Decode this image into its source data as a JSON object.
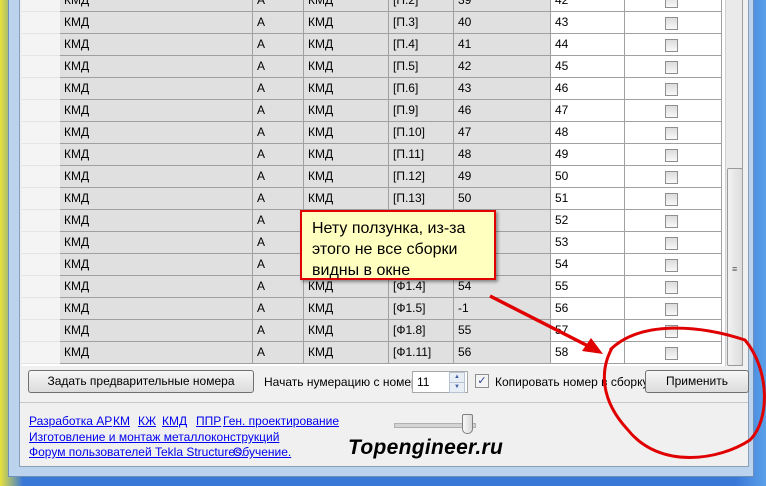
{
  "table": {
    "rows": [
      {
        "c1": "КМД",
        "c2": "А",
        "c3": "КМД",
        "c4": "[П.2]",
        "c5": "39",
        "c6": "42"
      },
      {
        "c1": "КМД",
        "c2": "А",
        "c3": "КМД",
        "c4": "[П.3]",
        "c5": "40",
        "c6": "43"
      },
      {
        "c1": "КМД",
        "c2": "А",
        "c3": "КМД",
        "c4": "[П.4]",
        "c5": "41",
        "c6": "44"
      },
      {
        "c1": "КМД",
        "c2": "А",
        "c3": "КМД",
        "c4": "[П.5]",
        "c5": "42",
        "c6": "45"
      },
      {
        "c1": "КМД",
        "c2": "А",
        "c3": "КМД",
        "c4": "[П.6]",
        "c5": "43",
        "c6": "46"
      },
      {
        "c1": "КМД",
        "c2": "А",
        "c3": "КМД",
        "c4": "[П.9]",
        "c5": "46",
        "c6": "47"
      },
      {
        "c1": "КМД",
        "c2": "А",
        "c3": "КМД",
        "c4": "[П.10]",
        "c5": "47",
        "c6": "48"
      },
      {
        "c1": "КМД",
        "c2": "А",
        "c3": "КМД",
        "c4": "[П.11]",
        "c5": "48",
        "c6": "49"
      },
      {
        "c1": "КМД",
        "c2": "А",
        "c3": "КМД",
        "c4": "[П.12]",
        "c5": "49",
        "c6": "50"
      },
      {
        "c1": "КМД",
        "c2": "А",
        "c3": "КМД",
        "c4": "[П.13]",
        "c5": "50",
        "c6": "51"
      },
      {
        "c1": "КМД",
        "c2": "А",
        "c6": "52"
      },
      {
        "c1": "КМД",
        "c2": "А",
        "c6": "53"
      },
      {
        "c1": "КМД",
        "c2": "А",
        "c6": "54"
      },
      {
        "c1": "КМД",
        "c2": "А",
        "c3": "КМД",
        "c4": "[Ф1.4]",
        "c5": "54",
        "c6": "55"
      },
      {
        "c1": "КМД",
        "c2": "А",
        "c3": "КМД",
        "c4": "[Ф1.5]",
        "c5": "-1",
        "c6": "56"
      },
      {
        "c1": "КМД",
        "c2": "А",
        "c3": "КМД",
        "c4": "[Ф1.8]",
        "c5": "55",
        "c6": "57"
      },
      {
        "c1": "КМД",
        "c2": "А",
        "c3": "КМД",
        "c4": "[Ф1.11]",
        "c5": "56",
        "c6": "58"
      }
    ]
  },
  "toolbar": {
    "preset_button": "Задать предварительные номера",
    "start_label": "Начать нумерацию с номера",
    "start_value": "11",
    "copy_label": "Копировать номер в сборку",
    "copy_checked": true,
    "apply_button": "Применить"
  },
  "links": {
    "ar": "Разработка АР",
    "km": "КМ",
    "kzh": "КЖ",
    "kmd": "КМД",
    "ppr": "ППР",
    "gen": "Ген. проектирование",
    "metal": "Изготовление и монтаж металлоконструкций",
    "forum": "Форум пользователей Tekla Structures.",
    "training": "Обучение."
  },
  "logo": "Topengineer.ru",
  "annotation": {
    "callout": "Нету ползунка, из-за этого не все сборки видны в окне",
    "color": "#e00000"
  }
}
